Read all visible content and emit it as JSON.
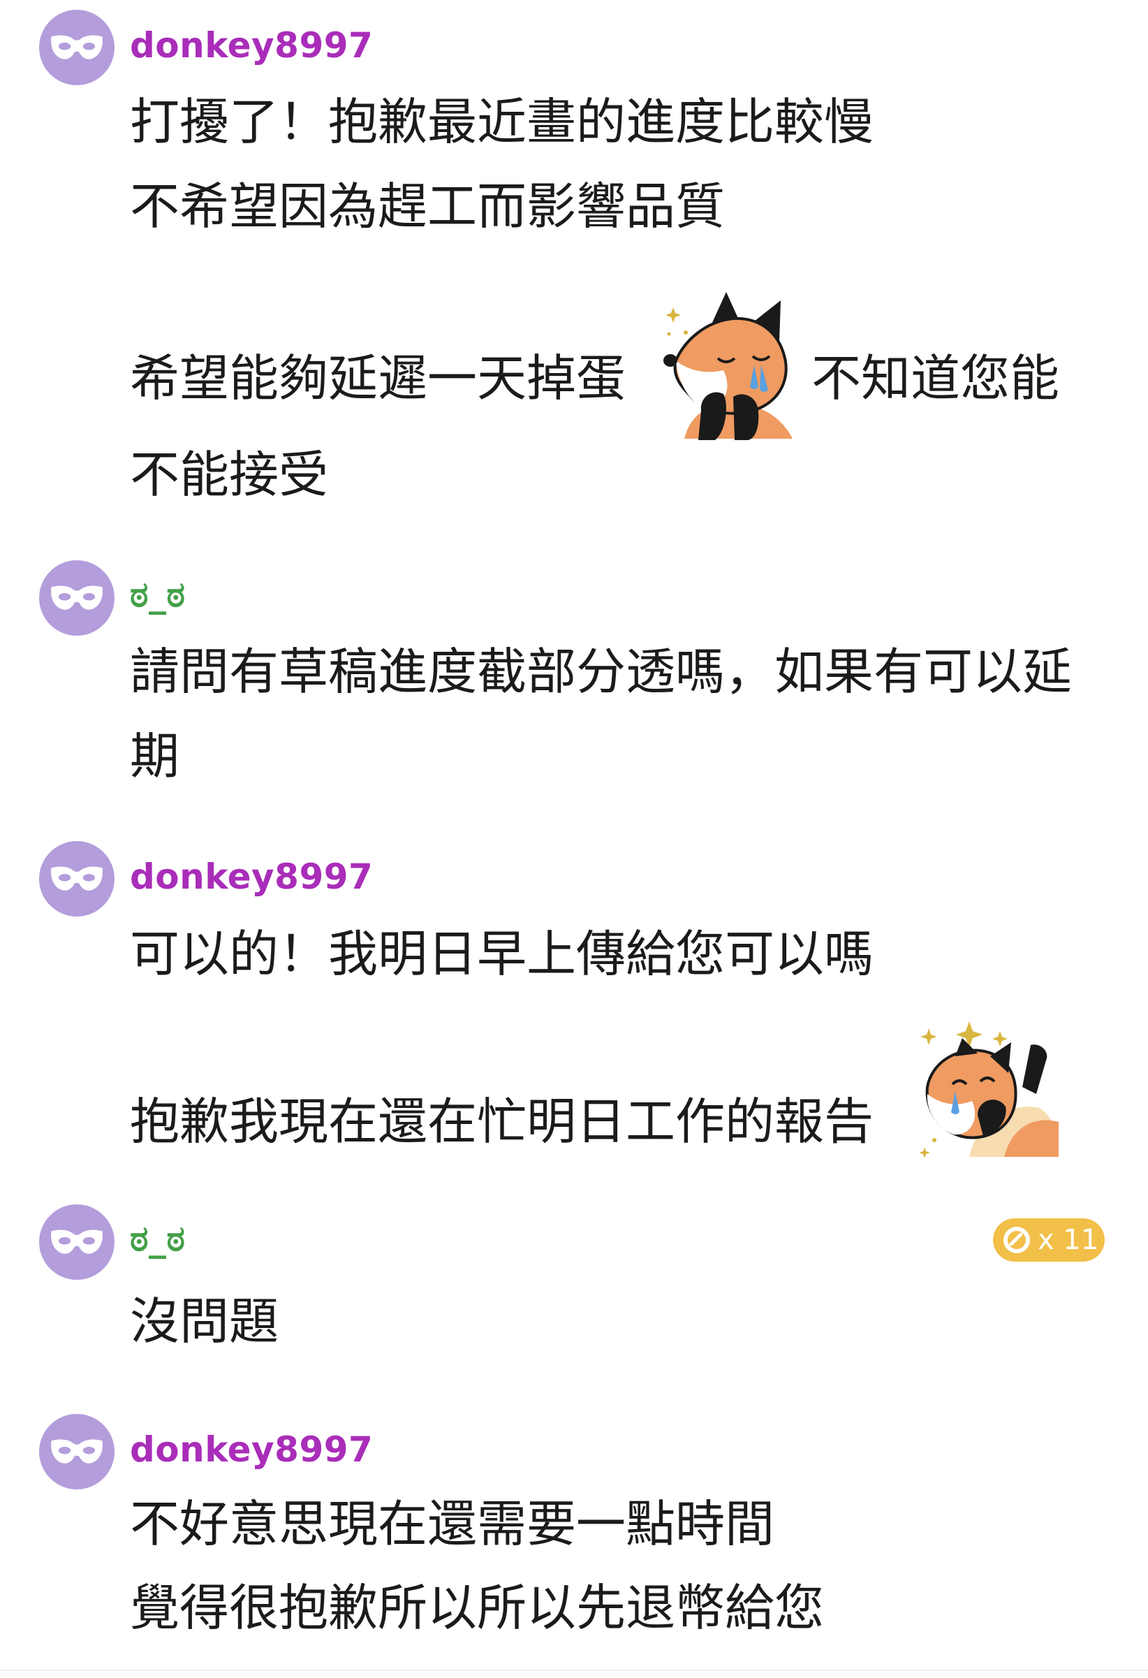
{
  "colors": {
    "username_a": "#a92db9",
    "username_b": "#43a047",
    "avatar_bg": "#b39ddb",
    "badge_bg": "#f2bf48"
  },
  "messages": [
    {
      "user": "donkey8997",
      "lines": [
        "打擾了！抱歉最近畫的進度比較慢",
        "不希望因為趕工而影響品質",
        "希望能夠延遲一天掉蛋",
        "不知道您能",
        "不能接受"
      ],
      "sticker": "crying-fox-sticker"
    },
    {
      "user": "ಠ_ಠ",
      "lines": [
        "請問有草稿進度截部分透嗎，如果有可以延",
        "期"
      ]
    },
    {
      "user": "donkey8997",
      "lines": [
        "可以的！我明日早上傳給您可以嗎",
        "抱歉我現在還在忙明日工作的報告"
      ],
      "sticker": "laughing-fox-sticker"
    },
    {
      "user": "ಠ_ಠ",
      "lines": [
        "沒問題"
      ],
      "badge": {
        "icon": "coin-icon",
        "count": "x 11"
      }
    },
    {
      "user": "donkey8997",
      "lines": [
        "不好意思現在還需要一點時間",
        "覺得很抱歉所以所以先退幣給您"
      ]
    }
  ]
}
